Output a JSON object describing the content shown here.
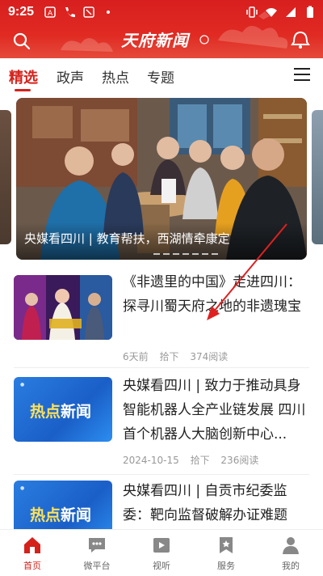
{
  "status_bar": {
    "time": "9:25"
  },
  "header": {
    "logo_text": "天府新闻",
    "colors": {
      "primary": "#d81f1f"
    }
  },
  "tabs": [
    {
      "label": "精选",
      "active": true
    },
    {
      "label": "政声",
      "active": false
    },
    {
      "label": "热点",
      "active": false
    },
    {
      "label": "专题",
      "active": false
    }
  ],
  "banner": {
    "caption": "央媒看四川 | 教育帮扶，西湖情牵康定"
  },
  "news": [
    {
      "title": "《非遗里的中国》走进四川：探寻川蜀天府之地的非遗瑰宝",
      "meta": {
        "time": "6天前",
        "source": "拾下",
        "reads": "374阅读"
      }
    },
    {
      "title": "央媒看四川 | 致力于推动具身智能机器人全产业链发展 四川首个机器人大脑创新中心...",
      "thumb_text_yellow": "热点",
      "thumb_text_white": "新闻",
      "meta": {
        "time": "2024-10-15",
        "source": "拾下",
        "reads": "236阅读"
      }
    },
    {
      "title": "央媒看四川 | 自贡市纪委监委：靶向监督破解办证难题",
      "thumb_text_yellow": "热点",
      "thumb_text_white": "新闻"
    }
  ],
  "bottom_nav": [
    {
      "label": "首页",
      "icon": "home-icon",
      "active": true
    },
    {
      "label": "微平台",
      "icon": "chat-icon",
      "active": false
    },
    {
      "label": "视听",
      "icon": "video-icon",
      "active": false
    },
    {
      "label": "服务",
      "icon": "service-icon",
      "active": false
    },
    {
      "label": "我的",
      "icon": "user-icon",
      "active": false
    }
  ]
}
